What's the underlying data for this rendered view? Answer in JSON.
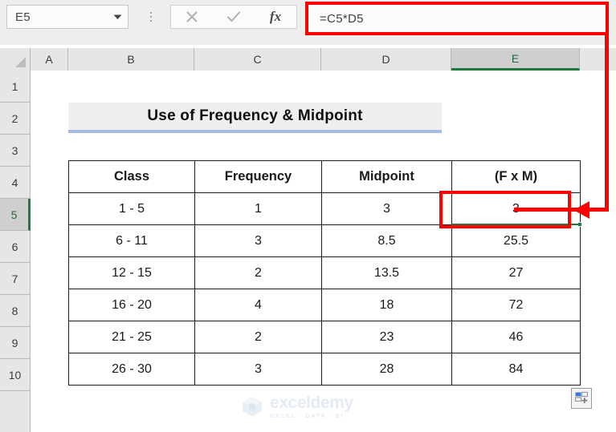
{
  "formula_bar": {
    "name_box_value": "E5",
    "name_box_dropdown_icon": "chevron-down-icon",
    "overflow_icon": "vertical-ellipsis-icon",
    "cancel_icon": "close-x-icon",
    "enter_icon": "checkmark-icon",
    "insert_function_icon": "fx-icon",
    "insert_function_label": "fx",
    "formula_value": "=C5*D5",
    "highlight_color": "#ff0000"
  },
  "grid": {
    "select_all_icon": "select-all-triangle-icon",
    "columns": [
      "A",
      "B",
      "C",
      "D",
      "E"
    ],
    "active_column": "E",
    "rows": [
      "1",
      "2",
      "3",
      "4",
      "5",
      "6",
      "7",
      "8",
      "9",
      "10"
    ],
    "active_row": "5",
    "active_cell": "E5",
    "selection_color": "#1f7a42"
  },
  "sheet": {
    "title": "Use of Frequency & Midpoint",
    "title_bg": "#efefef",
    "title_underline": "#a6bce0"
  },
  "table": {
    "headers": [
      "Class",
      "Frequency",
      "Midpoint",
      "(F x M)"
    ],
    "header_colors": [
      "#dfeada",
      "#fbd88d",
      "#fce7c0",
      "#d6e4f2"
    ],
    "rows": [
      {
        "class": "1 - 5",
        "frequency": "1",
        "midpoint": "3",
        "fxm": "3"
      },
      {
        "class": "6 - 11",
        "frequency": "3",
        "midpoint": "8.5",
        "fxm": "25.5"
      },
      {
        "class": "12 - 15",
        "frequency": "2",
        "midpoint": "13.5",
        "fxm": "27"
      },
      {
        "class": "16 - 20",
        "frequency": "4",
        "midpoint": "18",
        "fxm": "72"
      },
      {
        "class": "21 - 25",
        "frequency": "2",
        "midpoint": "23",
        "fxm": "46"
      },
      {
        "class": "26 - 30",
        "frequency": "3",
        "midpoint": "28",
        "fxm": "84"
      }
    ]
  },
  "annotation": {
    "arrow_icon": "red-arrow-left-icon",
    "color": "#ff0000",
    "target_cell": "E5"
  },
  "watermark": {
    "logo_icon": "exceldemy-cube-logo-icon",
    "name": "exceldemy",
    "tagline": "EXCEL - DATA - BI"
  },
  "quick_analysis": {
    "icon": "quick-analysis-icon",
    "tooltip": "Quick Analysis"
  }
}
